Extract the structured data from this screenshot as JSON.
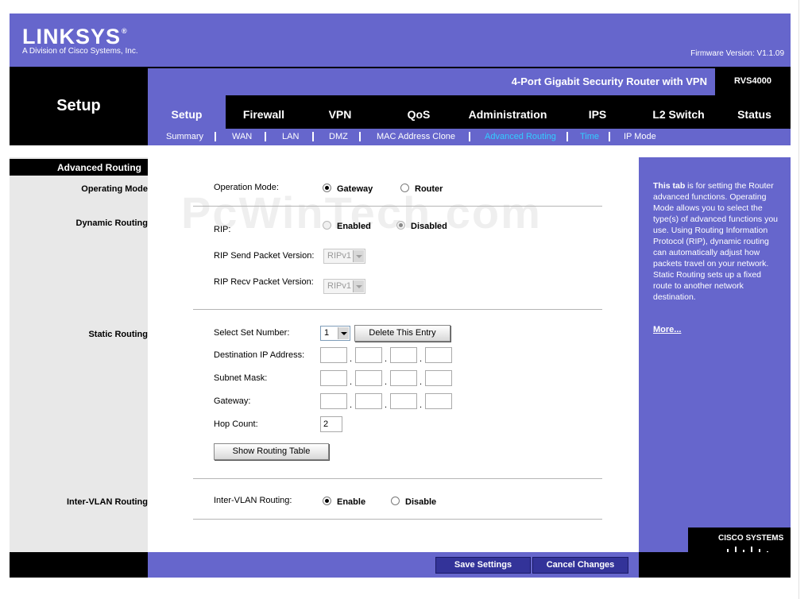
{
  "header": {
    "logo": "LINKSYS",
    "logo_reg": "®",
    "logo_sub": "A Division of Cisco Systems, Inc.",
    "firmware": "Firmware Version: V1.1.09",
    "product": "4-Port Gigabit Security Router with VPN",
    "model": "RVS4000",
    "section": "Setup"
  },
  "tabs": [
    "Setup",
    "Firewall",
    "VPN",
    "QoS",
    "Administration",
    "IPS",
    "L2 Switch",
    "Status"
  ],
  "subtabs": [
    "Summary",
    "WAN",
    "LAN",
    "DMZ",
    "MAC Address Clone",
    "Advanced Routing",
    "Time",
    "IP Mode"
  ],
  "sidebar": {
    "heading": "Advanced Routing",
    "operating_mode": "Operating Mode",
    "dynamic_routing": "Dynamic Routing",
    "static_routing": "Static Routing",
    "inter_vlan": "Inter-VLAN Routing"
  },
  "watermark": "PcWinTech.com",
  "form": {
    "operating_mode_label": "Operation Mode:",
    "gateway": "Gateway",
    "router": "Router",
    "rip_label": "RIP:",
    "enabled": "Enabled",
    "disabled": "Disabled",
    "rip_send_label": "RIP Send Packet Version:",
    "rip_send_value": "RIPv1",
    "rip_recv_label": "RIP Recv Packet Version:",
    "rip_recv_value": "RIPv1",
    "set_number_label": "Select Set Number:",
    "set_number_value": "1",
    "delete_entry": "Delete This Entry",
    "dest_ip_label": "Destination IP Address:",
    "subnet_label": "Subnet Mask:",
    "gateway_label": "Gateway:",
    "hop_label": "Hop Count:",
    "hop_value": "2",
    "show_table": "Show Routing Table",
    "intervlan_label": "Inter-VLAN Routing:",
    "enable": "Enable",
    "disable": "Disable",
    "dot": "."
  },
  "help": {
    "bold": "This tab",
    "text": " is for setting the Router advanced functions. Operating Mode allows you to select the type(s) of advanced functions you use. Using Routing Information Protocol (RIP), dynamic routing can automatically adjust how packets travel on your network. Static Routing sets up a fixed route to another network destination.",
    "more": "More..."
  },
  "footer": {
    "save": "Save Settings",
    "cancel": "Cancel Changes",
    "cisco": "CISCO SYSTEMS"
  },
  "colors": {
    "brand": "#6666cc",
    "selected_subtab": "#33ccff",
    "button": "#333399"
  }
}
